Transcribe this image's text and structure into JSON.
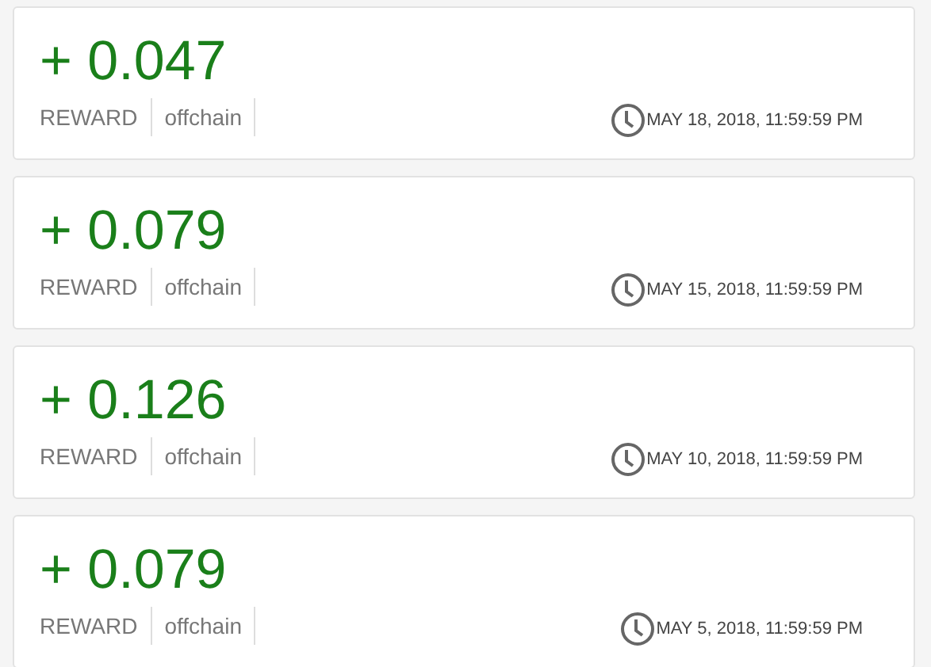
{
  "transactions": [
    {
      "amount": "+ 0.047",
      "type": "REWARD",
      "chain": "offchain",
      "date": "MAY 18, 2018, 11:59:59 PM"
    },
    {
      "amount": "+ 0.079",
      "type": "REWARD",
      "chain": "offchain",
      "date": "MAY 15, 2018, 11:59:59 PM"
    },
    {
      "amount": "+ 0.126",
      "type": "REWARD",
      "chain": "offchain",
      "date": "MAY 10, 2018, 11:59:59 PM"
    },
    {
      "amount": "+ 0.079",
      "type": "REWARD",
      "chain": "offchain",
      "date": "MAY 5, 2018, 11:59:59 PM"
    }
  ]
}
